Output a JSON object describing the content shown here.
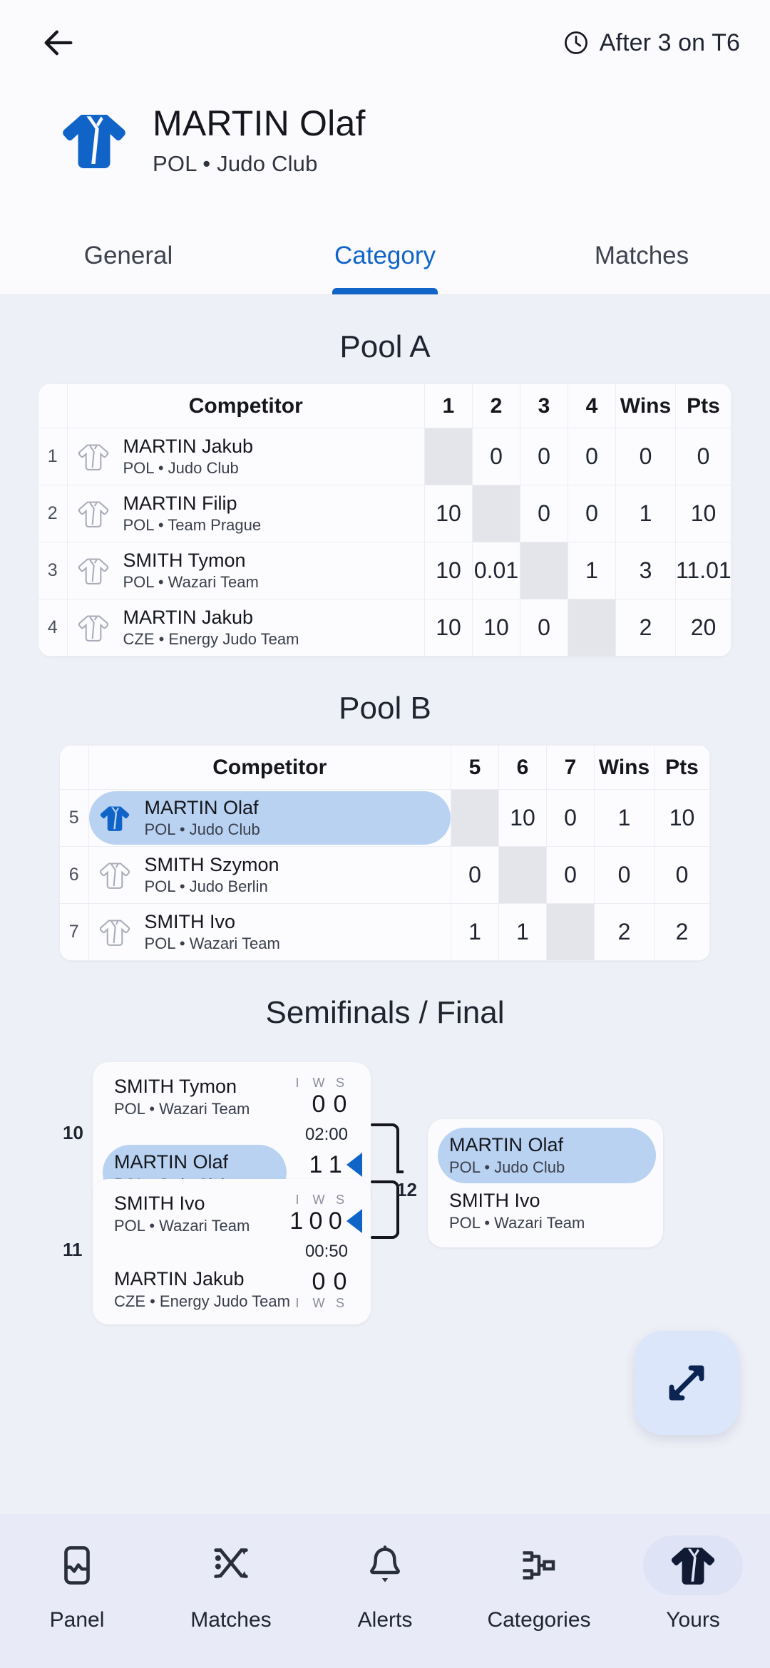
{
  "header": {
    "back_icon": "arrow-left-icon",
    "clock_icon": "clock-icon",
    "status": "After 3 on T6"
  },
  "athlete": {
    "gi_icon": "judogi-icon",
    "name": "MARTIN Olaf",
    "club": "POL • Judo Club"
  },
  "tabs": [
    {
      "label": "General",
      "active": false
    },
    {
      "label": "Category",
      "active": true
    },
    {
      "label": "Matches",
      "active": false
    }
  ],
  "pool_a": {
    "title": "Pool A",
    "columns": [
      "",
      "Competitor",
      "1",
      "2",
      "3",
      "4",
      "Wins",
      "Pts"
    ],
    "rows": [
      {
        "idx": "1",
        "name": "MARTIN Jakub",
        "club": "POL • Judo Club",
        "me": false,
        "cells": [
          "",
          "0",
          "0",
          "0"
        ],
        "diag": 0,
        "wins": "0",
        "pts": "0"
      },
      {
        "idx": "2",
        "name": "MARTIN Filip",
        "club": "POL • Team Prague",
        "me": false,
        "cells": [
          "10",
          "",
          "0",
          "0"
        ],
        "diag": 1,
        "wins": "1",
        "pts": "10"
      },
      {
        "idx": "3",
        "name": "SMITH Tymon",
        "club": "POL • Wazari Team",
        "me": false,
        "cells": [
          "10",
          "0.01",
          "",
          "1"
        ],
        "diag": 2,
        "wins": "3",
        "pts": "11.01"
      },
      {
        "idx": "4",
        "name": "MARTIN Jakub",
        "club": "CZE • Energy Judo Team",
        "me": false,
        "cells": [
          "10",
          "10",
          "0",
          ""
        ],
        "diag": 3,
        "wins": "2",
        "pts": "20"
      }
    ]
  },
  "pool_b": {
    "title": "Pool B",
    "columns": [
      "",
      "Competitor",
      "5",
      "6",
      "7",
      "Wins",
      "Pts"
    ],
    "rows": [
      {
        "idx": "5",
        "name": "MARTIN Olaf",
        "club": "POL • Judo Club",
        "me": true,
        "cells": [
          "",
          "10",
          "0"
        ],
        "diag": 0,
        "wins": "1",
        "pts": "10"
      },
      {
        "idx": "6",
        "name": "SMITH Szymon",
        "club": "POL • Judo Berlin",
        "me": false,
        "cells": [
          "0",
          "",
          "0"
        ],
        "diag": 1,
        "wins": "0",
        "pts": "0"
      },
      {
        "idx": "7",
        "name": "SMITH Ivo",
        "club": "POL • Wazari Team",
        "me": false,
        "cells": [
          "1",
          "1",
          ""
        ],
        "diag": 2,
        "wins": "2",
        "pts": "2"
      }
    ]
  },
  "bracket": {
    "title": "Semifinals / Final",
    "score_headers": [
      "I",
      "W",
      "S"
    ],
    "matches": [
      {
        "number": "10",
        "time": "02:00",
        "top": {
          "name": "SMITH Tymon",
          "club": "POL • Wazari Team",
          "me": false,
          "i": "",
          "w": "0",
          "s": "0",
          "winner": false
        },
        "bottom": {
          "name": "MARTIN Olaf",
          "club": "POL • Judo Club",
          "me": true,
          "i": "",
          "w": "1",
          "s": "1",
          "winner": true
        }
      },
      {
        "number": "11",
        "time": "00:50",
        "top": {
          "name": "SMITH Ivo",
          "club": "POL • Wazari Team",
          "me": false,
          "i": "1",
          "w": "0",
          "s": "0",
          "winner": true
        },
        "bottom": {
          "name": "MARTIN Jakub",
          "club": "CZE • Energy Judo Team",
          "me": false,
          "i": "",
          "w": "0",
          "s": "0",
          "winner": false
        }
      },
      {
        "number": "12",
        "time": "",
        "top": {
          "name": "MARTIN Olaf",
          "club": "POL • Judo Club",
          "me": true,
          "i": "",
          "w": "",
          "s": "",
          "winner": false
        },
        "bottom": {
          "name": "SMITH Ivo",
          "club": "POL • Wazari Team",
          "me": false,
          "i": "",
          "w": "",
          "s": "",
          "winner": false
        }
      }
    ]
  },
  "fab": {
    "icon": "expand-diagonal-icon"
  },
  "bottom_nav": [
    {
      "label": "Panel",
      "icon": "panel-icon",
      "active": false
    },
    {
      "label": "Matches",
      "icon": "matches-icon",
      "active": false
    },
    {
      "label": "Alerts",
      "icon": "bell-icon",
      "active": false
    },
    {
      "label": "Categories",
      "icon": "bracket-icon",
      "active": false
    },
    {
      "label": "Yours",
      "icon": "judogi-icon",
      "active": true
    }
  ],
  "colors": {
    "accent": "#1064c8",
    "highlight": "#b9d2f2",
    "page_bg": "#eef0f7",
    "card_bg": "#fbfbfe",
    "nav_bg": "#e8ebf7"
  }
}
